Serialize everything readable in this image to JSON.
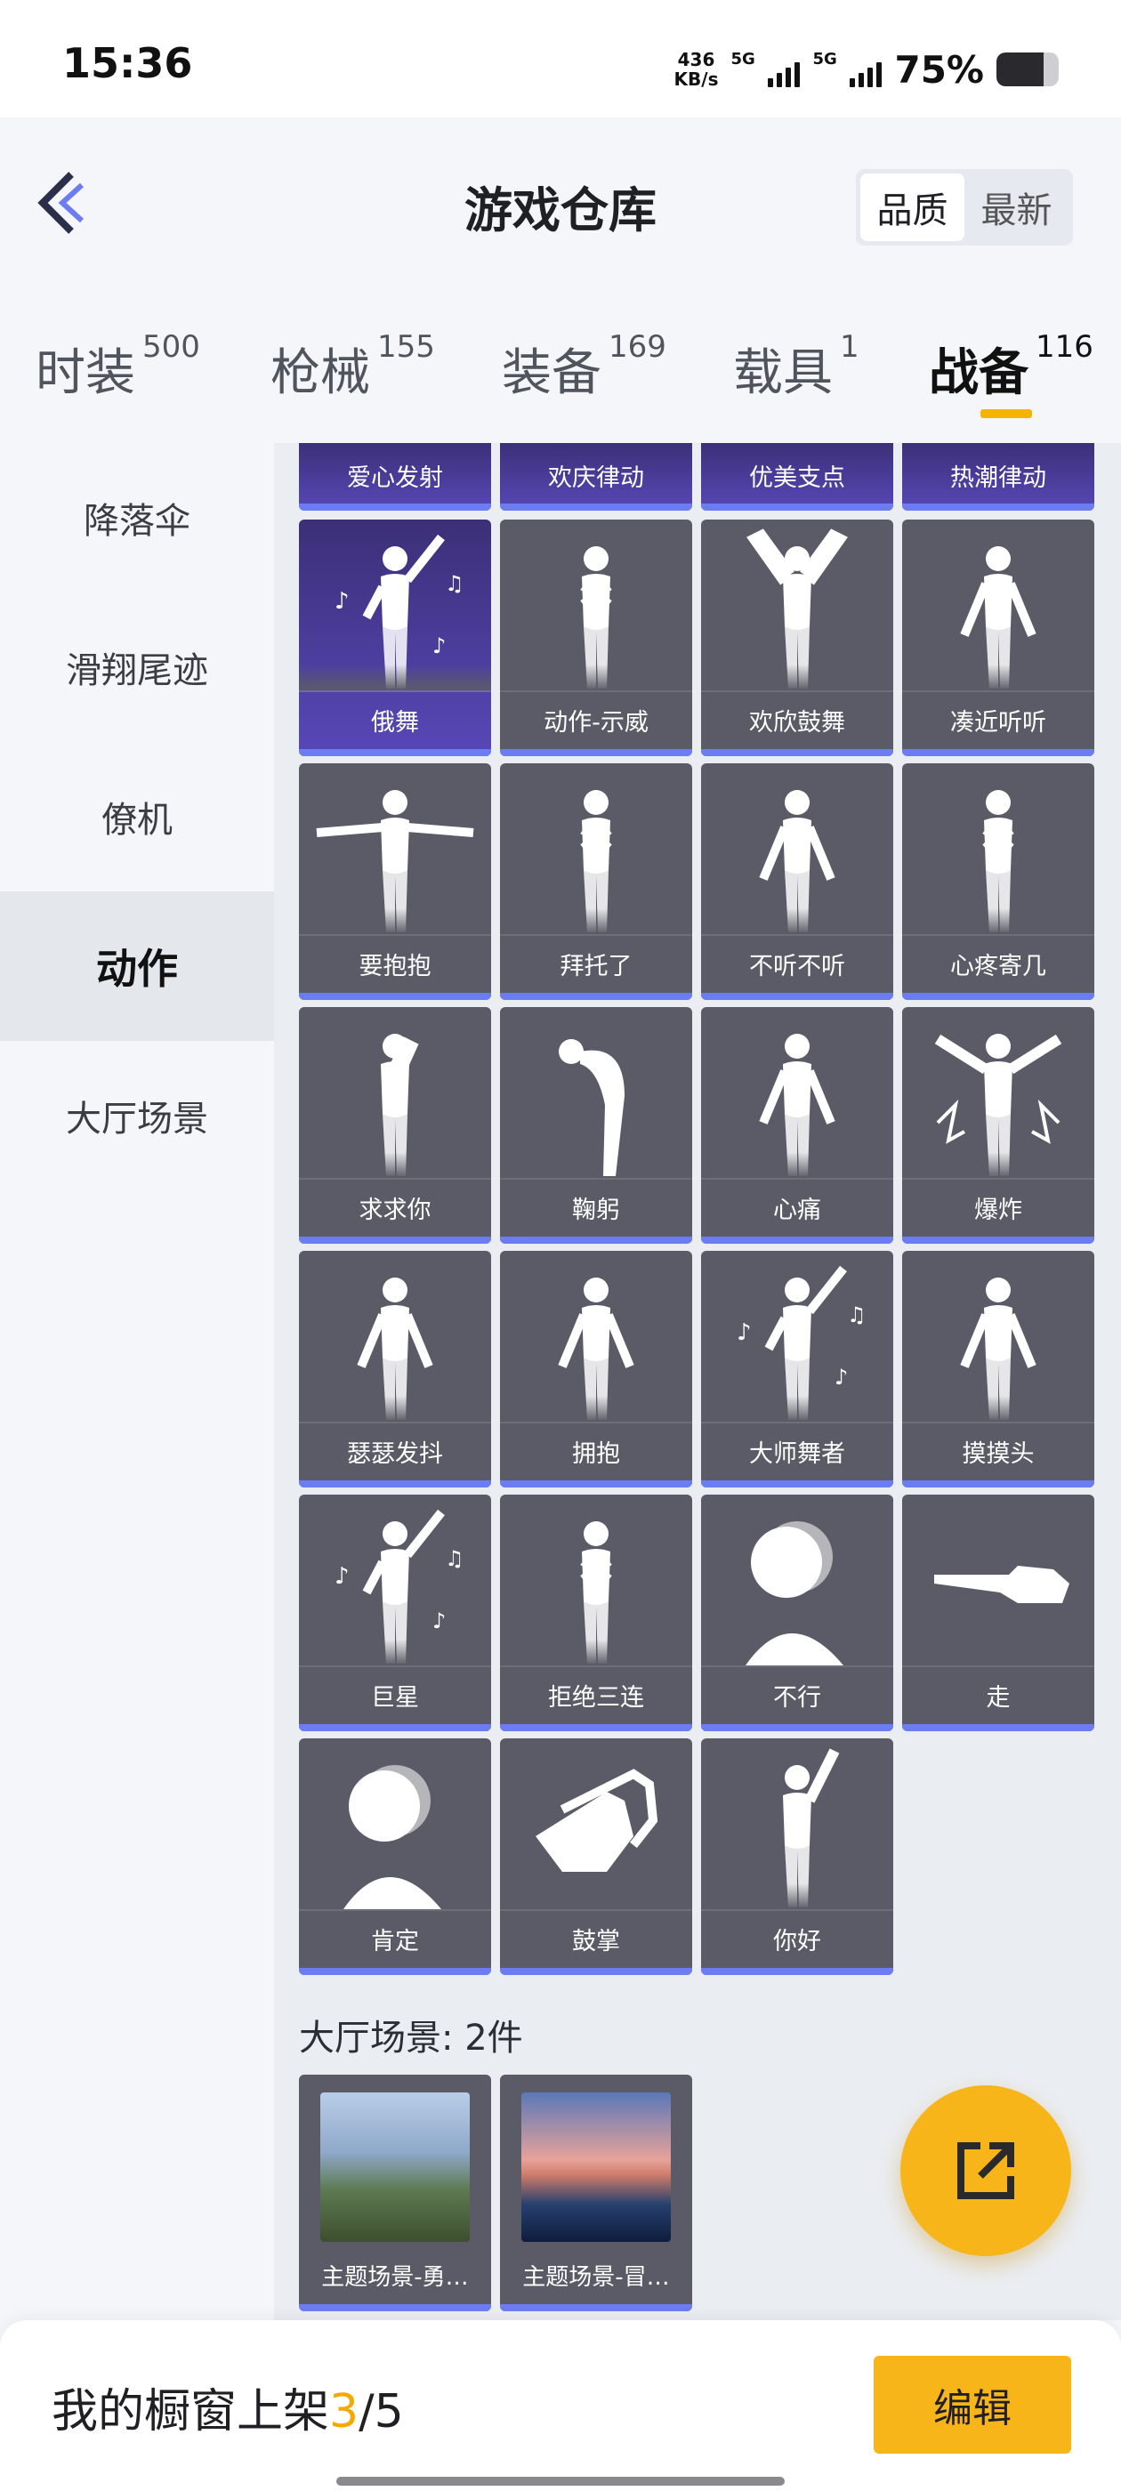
{
  "status_bar": {
    "time": "15:36",
    "net_speed_value": "436",
    "net_speed_unit": "KB/s",
    "signal1_label": "5G",
    "signal2_label": "5G",
    "battery_percent": "75%",
    "battery_level": 0.75
  },
  "header": {
    "title": "游戏仓库",
    "sort_options": [
      "品质",
      "最新"
    ],
    "sort_selected": "品质"
  },
  "tabs": [
    {
      "label": "时装",
      "count": "500"
    },
    {
      "label": "枪械",
      "count": "155"
    },
    {
      "label": "装备",
      "count": "169"
    },
    {
      "label": "载具",
      "count": "1"
    },
    {
      "label": "战备",
      "count": "116",
      "active": true
    }
  ],
  "sidebar": {
    "items": [
      {
        "label": "降落伞"
      },
      {
        "label": "滑翔尾迹"
      },
      {
        "label": "僚机"
      },
      {
        "label": "动作",
        "active": true
      },
      {
        "label": "大厅场景"
      }
    ]
  },
  "top_strip": [
    "爱心发射",
    "欢庆律动",
    "优美支点",
    "热潮律动"
  ],
  "emotes": [
    {
      "name": "俄舞",
      "icon": "dancer-with-notes-icon",
      "rarity": "purple"
    },
    {
      "name": "动作-示威",
      "icon": "arms-crossed-fist-icon"
    },
    {
      "name": "欢欣鼓舞",
      "icon": "arms-raised-icon"
    },
    {
      "name": "凑近听听",
      "icon": "ear-listen-icon"
    },
    {
      "name": "要抱抱",
      "icon": "arms-open-hug-icon"
    },
    {
      "name": "拜托了",
      "icon": "praying-hands-icon"
    },
    {
      "name": "不听不听",
      "icon": "covering-ears-icon"
    },
    {
      "name": "心疼寄几",
      "icon": "self-hug-icon"
    },
    {
      "name": "求求你",
      "icon": "kneeling-beg-icon"
    },
    {
      "name": "鞠躬",
      "icon": "bow-icon"
    },
    {
      "name": "心痛",
      "icon": "heart-ache-icon"
    },
    {
      "name": "爆炸",
      "icon": "explosion-pose-icon"
    },
    {
      "name": "瑟瑟发抖",
      "icon": "shiver-icon"
    },
    {
      "name": "拥抱",
      "icon": "embrace-icon"
    },
    {
      "name": "大师舞者",
      "icon": "master-dancer-icon"
    },
    {
      "name": "摸摸头",
      "icon": "pat-head-icon"
    },
    {
      "name": "巨星",
      "icon": "superstar-icon"
    },
    {
      "name": "拒绝三连",
      "icon": "arms-cross-refuse-icon"
    },
    {
      "name": "不行",
      "icon": "head-shake-icon"
    },
    {
      "name": "走",
      "icon": "pointing-hand-icon"
    },
    {
      "name": "肯定",
      "icon": "head-nod-icon"
    },
    {
      "name": "鼓掌",
      "icon": "clapping-hands-icon"
    },
    {
      "name": "你好",
      "icon": "waving-hello-icon"
    }
  ],
  "scene_section": {
    "title": "大厅场景: 2件",
    "items": [
      {
        "name": "主题场景-勇…",
        "icon": "mountain-castle-scene"
      },
      {
        "name": "主题场景-冒…",
        "icon": "sunset-sea-scene"
      }
    ]
  },
  "fab": {
    "icon": "share-export-icon"
  },
  "bottom_bar": {
    "label": "我的橱窗上架",
    "current": "3",
    "separator": "/",
    "total": "5",
    "edit_label": "编辑"
  },
  "colors": {
    "accent": "#f7b51a",
    "card": "#5b5b67",
    "card_bar": "#6c7cf2",
    "purple_card": "#5748b8"
  }
}
